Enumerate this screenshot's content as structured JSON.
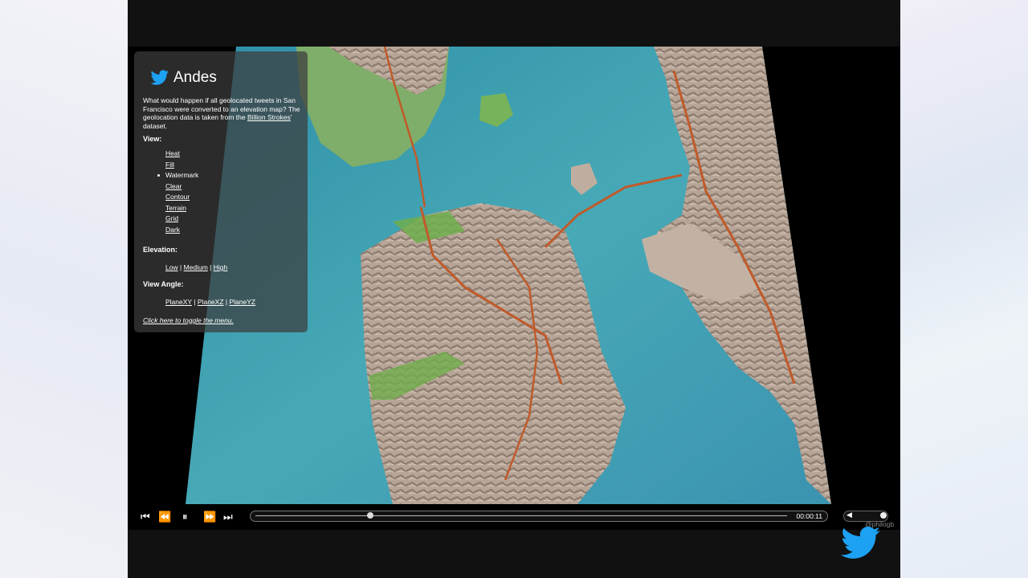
{
  "app": {
    "title": "Andes",
    "logo_icon": "twitter-bird-icon"
  },
  "intro": {
    "text_before": "What would happen if all geolocated tweets in San Francisco were converted to an elevation map? The geolocation data is taken from the ",
    "link": "Billion Strokes",
    "text_after": "' dataset."
  },
  "view": {
    "heading": "View:",
    "items": [
      "Heat",
      "Fill",
      "Watermark",
      "Clear",
      "Contour",
      "Terrain",
      "Grid",
      "Dark"
    ],
    "selected": "Watermark"
  },
  "elevation": {
    "heading": "Elevation:",
    "options": [
      "Low",
      "Medium",
      "High"
    ],
    "sep": "|"
  },
  "view_angle": {
    "heading": "View Angle:",
    "options": [
      "PlaneXY",
      "PlaneXZ",
      "PlaneYZ"
    ],
    "sep": "|"
  },
  "toggle_link": "Click here to toggle the menu.",
  "player": {
    "time": "00:00:11",
    "progress_fraction": 0.21,
    "buttons": {
      "skip_back": "⏮",
      "rewind": "⏪",
      "pause": "⏸",
      "fast_forward": "⏩",
      "skip_forward": "⏭"
    },
    "volume_fraction": 1.0
  },
  "watermark": {
    "handle": "@philogb"
  },
  "colors": {
    "accent": "#1da1f2",
    "water": "#3d9fb0",
    "land": "#b9a89a",
    "park": "#6fae4c",
    "road": "#c05a2a"
  }
}
